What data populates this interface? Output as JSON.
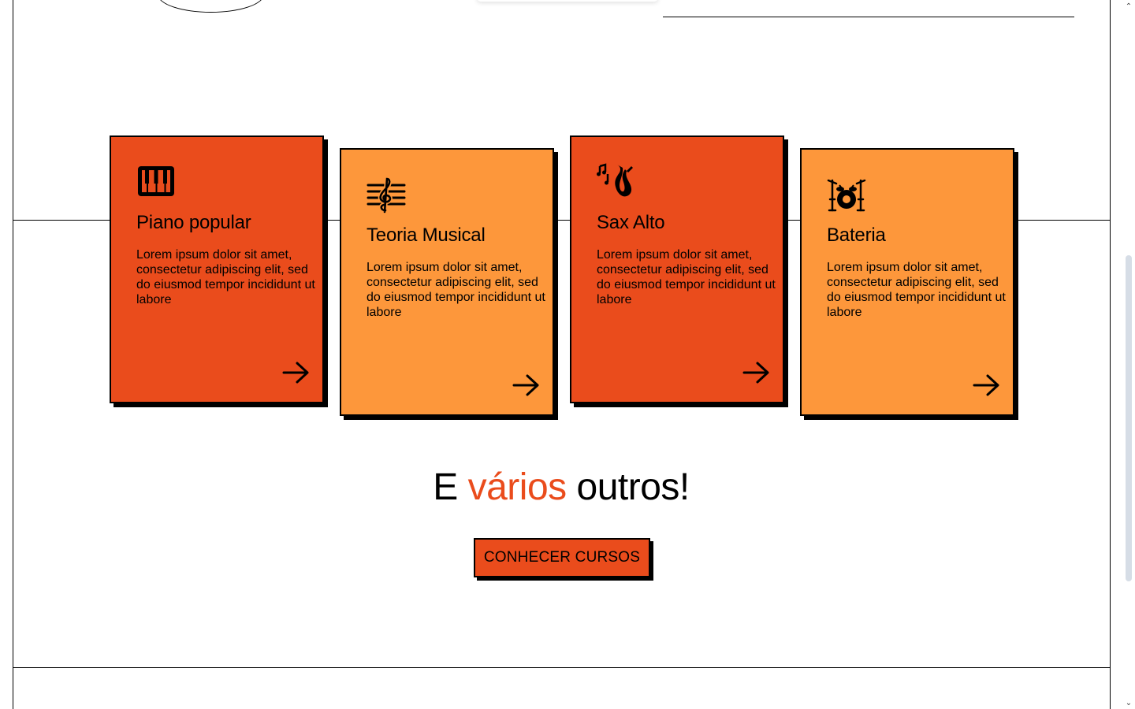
{
  "courses": [
    {
      "title": "Piano popular",
      "description": "Lorem ipsum dolor sit amet, consectetur adipiscing elit, sed do eiusmod tempor incididunt ut labore",
      "icon": "piano-icon",
      "color": "#ea4c1c"
    },
    {
      "title": "Teoria Musical",
      "description": "Lorem ipsum dolor sit amet, consectetur adipiscing elit, sed do eiusmod tempor incididunt ut labore",
      "icon": "sheet-music-icon",
      "color": "#fd973b"
    },
    {
      "title": "Sax Alto",
      "description": "Lorem ipsum dolor sit amet, consectetur adipiscing elit, sed do eiusmod tempor incididunt ut labore",
      "icon": "saxophone-icon",
      "color": "#ea4c1c"
    },
    {
      "title": "Bateria",
      "description": "Lorem ipsum dolor sit amet, consectetur adipiscing elit, sed do eiusmod tempor incididunt ut labore",
      "icon": "drum-kit-icon",
      "color": "#fd973b"
    }
  ],
  "headline": {
    "part1": "E ",
    "accent": "vários",
    "part2": " outros!"
  },
  "cta": {
    "label": "CONHECER CURSOS"
  },
  "colors": {
    "accent": "#ea4c1c",
    "secondary": "#fd973b"
  }
}
